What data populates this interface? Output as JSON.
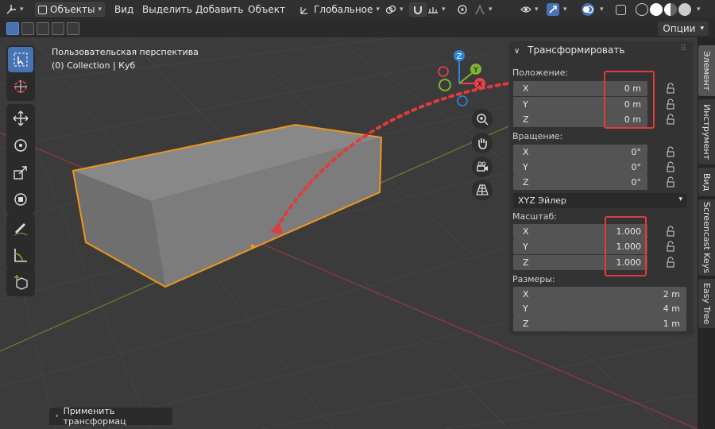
{
  "header": {
    "mode_label": "Объекты",
    "menus": [
      "Вид",
      "Выделить",
      "Добавить",
      "Объект"
    ],
    "orientation_label": "Глобальное"
  },
  "toolbar2": {
    "options_label": "Опции"
  },
  "viewport": {
    "perspective_label": "Пользовательская перспектива",
    "collection_label": "(0) Collection | Куб",
    "gizmo": {
      "x": "X",
      "y": "Y",
      "z": "Z"
    }
  },
  "npanel": {
    "title": "Трансформировать",
    "location": {
      "label": "Положение:",
      "rows": [
        {
          "axis": "X",
          "value": "0 m"
        },
        {
          "axis": "Y",
          "value": "0 m"
        },
        {
          "axis": "Z",
          "value": "0 m"
        }
      ]
    },
    "rotation": {
      "label": "Вращение:",
      "rows": [
        {
          "axis": "X",
          "value": "0°"
        },
        {
          "axis": "Y",
          "value": "0°"
        },
        {
          "axis": "Z",
          "value": "0°"
        }
      ]
    },
    "rotation_mode": "XYZ Эйлер",
    "scale": {
      "label": "Масштаб:",
      "rows": [
        {
          "axis": "X",
          "value": "1.000"
        },
        {
          "axis": "Y",
          "value": "1.000"
        },
        {
          "axis": "Z",
          "value": "1.000"
        }
      ]
    },
    "dimensions": {
      "label": "Размеры:",
      "rows": [
        {
          "axis": "X",
          "value": "2 m"
        },
        {
          "axis": "Y",
          "value": "4 m"
        },
        {
          "axis": "Z",
          "value": "1 m"
        }
      ]
    }
  },
  "tabs": [
    "Элемент",
    "Инструмент",
    "Вид",
    "Screencast Keys",
    "Easy Tree"
  ],
  "last_operator": "Применить трансформац",
  "colors": {
    "selection_outline": "#f0951c",
    "axis_x": "#e8424f",
    "axis_y": "#7fb333",
    "axis_z": "#2e86d8",
    "annotation": "#e23b3b"
  }
}
